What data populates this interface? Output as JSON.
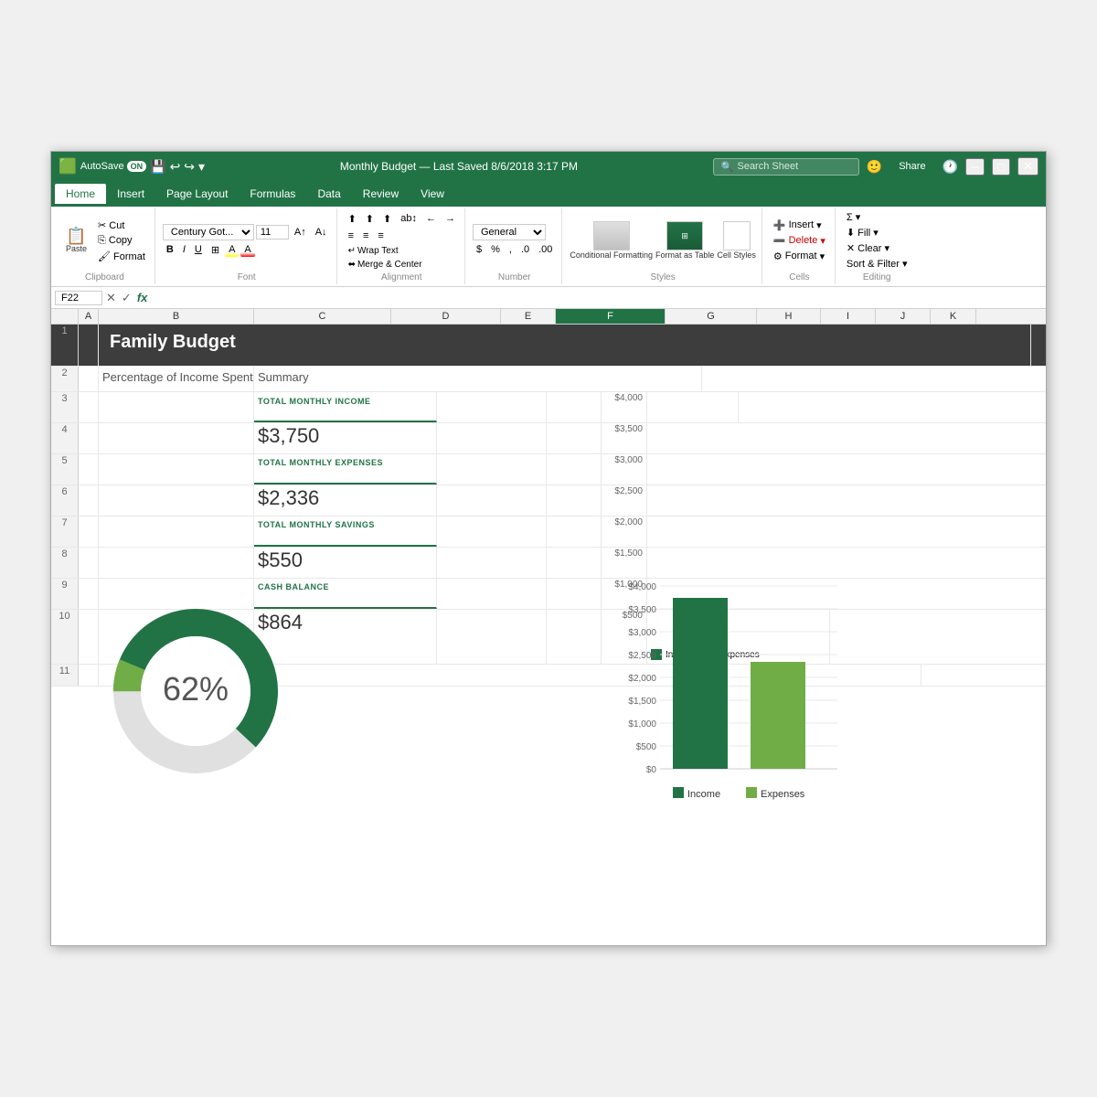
{
  "titlebar": {
    "autosave_label": "AutoSave",
    "autosave_state": "ON",
    "title": "Monthly Budget — Last Saved 8/6/2018 3:17 PM",
    "search_placeholder": "Search Sheet",
    "share_label": "Share",
    "excel_icon": "🟩"
  },
  "ribbon": {
    "tabs": [
      "Home",
      "Insert",
      "Page Layout",
      "Formulas",
      "Data",
      "Review",
      "View"
    ],
    "active_tab": "Home",
    "font_name": "Century Got...",
    "font_size": "11",
    "number_format": "General",
    "wrap_text": "Wrap Text",
    "merge_center": "Merge & Center",
    "conditional_formatting": "Conditional Formatting",
    "format_as_table": "Format as Table",
    "cell_styles": "Cell Styles",
    "insert_label": "Insert",
    "delete_label": "Delete",
    "format_label": "Format",
    "sort_filter": "Sort & Filter",
    "sum_symbol": "Σ",
    "clipboard_label": "Clipboard",
    "font_label": "Font",
    "alignment_label": "Alignment",
    "number_label": "Number",
    "styles_label": "Styles",
    "cells_label": "Cells",
    "editing_label": "Editing"
  },
  "formula_bar": {
    "cell_ref": "F22",
    "formula": "fx"
  },
  "columns": [
    "A",
    "B",
    "C",
    "D",
    "E",
    "F",
    "G",
    "H",
    "I",
    "J",
    "K"
  ],
  "spreadsheet": {
    "title": "Family Budget",
    "pct_income_label": "Percentage of Income Spent",
    "donut_pct": "62%",
    "donut_income_value": 3750,
    "donut_expenses_value": 2336,
    "summary_title": "Summary",
    "summary_items": [
      {
        "label": "TOTAL MONTHLY INCOME",
        "value": "$3,750"
      },
      {
        "label": "TOTAL MONTHLY EXPENSES",
        "value": "$2,336"
      },
      {
        "label": "TOTAL MONTHLY SAVINGS",
        "value": "$550"
      },
      {
        "label": "CASH BALANCE",
        "value": "$864"
      }
    ],
    "bar_chart": {
      "y_labels": [
        "$4,000",
        "$3,500",
        "$3,000",
        "$2,500",
        "$2,000",
        "$1,500",
        "$1,000",
        "$500",
        "$0"
      ],
      "income_value": 3750,
      "expenses_value": 2336,
      "max_value": 4000,
      "legend": [
        {
          "color": "#217346",
          "label": "Income"
        },
        {
          "color": "#70ad47",
          "label": "Expenses"
        }
      ]
    }
  },
  "rows": [
    1,
    2,
    3,
    4,
    5,
    6,
    7,
    8,
    9,
    10,
    11
  ]
}
